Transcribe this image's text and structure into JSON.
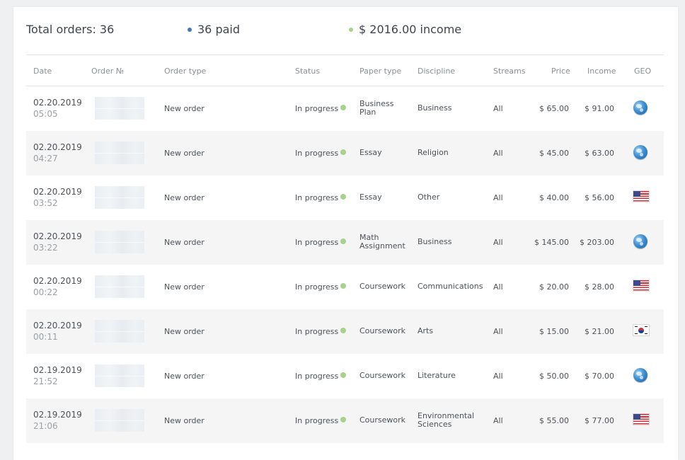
{
  "summary": {
    "total_orders": "Total orders: 36",
    "paid": "36 paid",
    "income": "$ 2016.00 income",
    "paid_dot_color": "#3d7ab8",
    "income_dot_color": "#a9d18e"
  },
  "table": {
    "headers": {
      "date": "Date",
      "order": "Order №",
      "order_type": "Order type",
      "status": "Status",
      "paper_type": "Paper type",
      "discipline": "Discipline",
      "streams": "Streams",
      "price": "Price",
      "income": "Income",
      "geo": "GEO"
    },
    "rows": [
      {
        "date": "02.20.2019",
        "time": "05:05",
        "order_type": "New order",
        "status": "In progress",
        "paper_type": "Business\nPlan",
        "discipline": "Business",
        "streams": "All",
        "price": "$ 65.00",
        "income": "$ 91.00",
        "geo": "globe-icon"
      },
      {
        "date": "02.20.2019",
        "time": "04:27",
        "order_type": "New order",
        "status": "In progress",
        "paper_type": "Essay",
        "discipline": "Religion",
        "streams": "All",
        "price": "$ 45.00",
        "income": "$ 63.00",
        "geo": "globe-icon"
      },
      {
        "date": "02.20.2019",
        "time": "03:52",
        "order_type": "New order",
        "status": "In progress",
        "paper_type": "Essay",
        "discipline": "Other",
        "streams": "All",
        "price": "$ 40.00",
        "income": "$ 56.00",
        "geo": "us-flag-icon"
      },
      {
        "date": "02.20.2019",
        "time": "03:22",
        "order_type": "New order",
        "status": "In progress",
        "paper_type": "Math\nAssignment",
        "discipline": "Business",
        "streams": "All",
        "price": "$ 145.00",
        "income": "$ 203.00",
        "geo": "globe-icon"
      },
      {
        "date": "02.20.2019",
        "time": "00:22",
        "order_type": "New order",
        "status": "In progress",
        "paper_type": "Coursework",
        "discipline": "Communications",
        "streams": "All",
        "price": "$ 20.00",
        "income": "$ 28.00",
        "geo": "us-flag-icon"
      },
      {
        "date": "02.20.2019",
        "time": "00:11",
        "order_type": "New order",
        "status": "In progress",
        "paper_type": "Coursework",
        "discipline": "Arts",
        "streams": "All",
        "price": "$ 15.00",
        "income": "$ 21.00",
        "geo": "kr-flag-icon"
      },
      {
        "date": "02.19.2019",
        "time": "21:52",
        "order_type": "New order",
        "status": "In progress",
        "paper_type": "Coursework",
        "discipline": "Literature",
        "streams": "All",
        "price": "$ 50.00",
        "income": "$ 70.00",
        "geo": "globe-icon"
      },
      {
        "date": "02.19.2019",
        "time": "21:06",
        "order_type": "New order",
        "status": "In progress",
        "paper_type": "Coursework",
        "discipline": "Environmental\nSciences",
        "streams": "All",
        "price": "$ 55.00",
        "income": "$ 77.00",
        "geo": "us-flag-icon"
      }
    ]
  }
}
